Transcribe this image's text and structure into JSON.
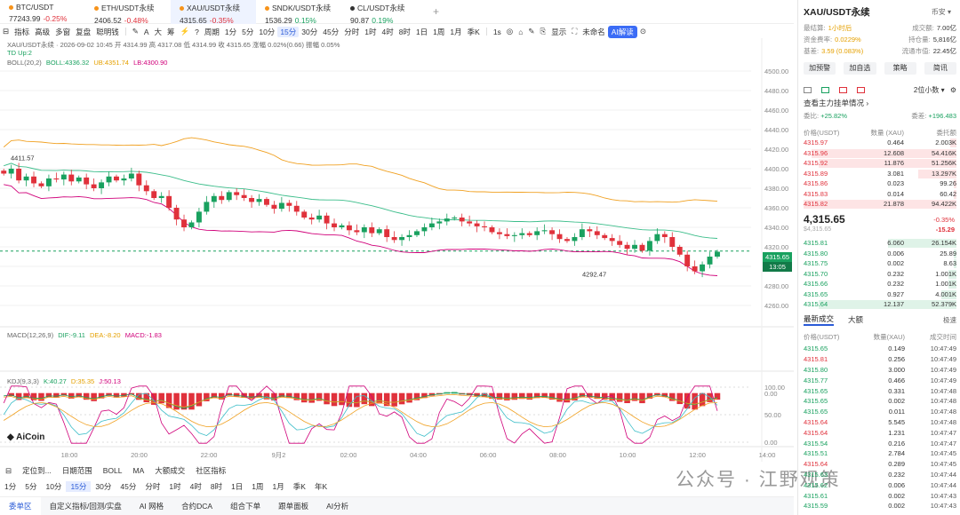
{
  "tickers": [
    {
      "name": "BTC/USDT",
      "price": "77243.99",
      "change": "-0.25%",
      "dir": "neg",
      "dot": "#f7931a"
    },
    {
      "name": "ETH/USDT永续",
      "price": "2406.52",
      "change": "-0.48%",
      "dir": "neg",
      "dot": "#f7931a"
    },
    {
      "name": "XAU/USDT永续",
      "price": "4315.65",
      "change": "-0.35%",
      "dir": "neg",
      "dot": "#f7931a"
    },
    {
      "name": "SNDK/USDT永续",
      "price": "1536.29",
      "change": "0.15%",
      "dir": "pos",
      "dot": "#f7931a"
    },
    {
      "name": "CL/USDT永续",
      "price": "90.87",
      "change": "0.19%",
      "dir": "pos",
      "dot": "#333333"
    }
  ],
  "toolbar": {
    "left": [
      "指标",
      "高级",
      "多窗",
      "复盘",
      "聪明钱"
    ],
    "period": "周期",
    "intervals": [
      "1分",
      "5分",
      "10分",
      "15分",
      "30分",
      "45分",
      "分时",
      "1时",
      "4时",
      "8时",
      "1日",
      "1周",
      "1月",
      "季K"
    ],
    "selected_interval": "15分",
    "fs": "1s",
    "display": "显示",
    "unnamed": "未命名",
    "ai": "AI解读"
  },
  "chart": {
    "info_line": "XAU/USDT永续 · 2026-09-02 10:45  开 4314.99  高 4317.08  低 4314.99  收 4315.65  涨幅 0.02%(0.66)  振幅 0.05%",
    "td": "TD  Up:2",
    "boll": {
      "label": "BOLL(20,2)",
      "boll": "BOLL:4336.32",
      "ub": "UB:4351.74",
      "lb": "LB:4300.90"
    },
    "macd": {
      "label": "MACD(12,26,9)",
      "dif": "DIF:-9.11",
      "dea": "DEA:-8.20",
      "macd": "MACD:-1.83"
    },
    "kdj": {
      "label": "KDJ(9,3,3)",
      "k": "K:40.27",
      "d": "D:35.35",
      "j": "J:50.13"
    },
    "price_axis": [
      "4500.00",
      "4480.00",
      "4460.00",
      "4440.00",
      "4420.00",
      "4400.00",
      "4380.00",
      "4360.00",
      "4340.00",
      "4320.00",
      "4300.00",
      "4280.00",
      "4260.00"
    ],
    "macd_axis": [
      "0.00"
    ],
    "kdj_axis": [
      "100.00",
      "50.00",
      "0.00"
    ],
    "time_axis": [
      "18:00",
      "20:00",
      "22:00",
      "9月2",
      "02:00",
      "04:00",
      "06:00",
      "08:00",
      "10:00",
      "12:00",
      "14:00"
    ],
    "current_price": "4315.65",
    "countdown": "13:05",
    "high_mark": "4411.57",
    "low_mark": "4292.47",
    "watermark": "AiCoin"
  },
  "bottom": {
    "row1": [
      "定位到...",
      "日期范围",
      "BOLL",
      "MA",
      "大额成交",
      "社区指标"
    ],
    "row2": [
      "1分",
      "5分",
      "10分",
      "15分",
      "30分",
      "45分",
      "分时",
      "1时",
      "4时",
      "8时",
      "1日",
      "1周",
      "1月",
      "季K",
      "年K"
    ],
    "row2_selected": "15分",
    "row3": [
      "委单区",
      "自定义指标/回测/实盘",
      "AI 网格",
      "合约DCA",
      "组合下单",
      "跟单面板",
      "AI分析"
    ],
    "row3_selected": "委单区"
  },
  "right": {
    "symbol": "XAU/USDT永续",
    "exchange": "币安",
    "stats": [
      [
        "最结算:",
        "1小时后",
        "成交额:",
        "7.00亿"
      ],
      [
        "资金费率:",
        "0.0229%",
        "持仓量:",
        "5,816亿"
      ],
      [
        "基差:",
        "3.59 (0.083%)",
        "流通市值:",
        "22.45亿"
      ]
    ],
    "buttons": [
      "加预警",
      "加自选",
      "策略",
      "简讯"
    ],
    "depth_sel": "2位小数",
    "main_flow": "查看主力挂单情况",
    "ratio_left_k": "委比:",
    "ratio_left_v": "+25.82%",
    "ratio_right_k": "委差:",
    "ratio_right_v": "+196.483",
    "ob_headers": [
      "价格(USDT)",
      "数量 (XAU)",
      "委托额"
    ],
    "asks": [
      [
        "4315.97",
        "0.464",
        "2.003K",
        0.04
      ],
      [
        "4315.96",
        "12.608",
        "54.416K",
        0.95
      ],
      [
        "4315.92",
        "11.876",
        "51.256K",
        0.9
      ],
      [
        "4315.89",
        "3.081",
        "13.297K",
        0.25
      ],
      [
        "4315.86",
        "0.023",
        "99.26",
        0.02
      ],
      [
        "4315.83",
        "0.014",
        "60.42",
        0.02
      ],
      [
        "4315.82",
        "21.878",
        "94.422K",
        1.0
      ]
    ],
    "mid_price": "4,315.65",
    "mid_sub": "$4,315.65",
    "mid_pct": "-0.35%",
    "mid_abs": "-15.29",
    "bids": [
      [
        "4315.81",
        "6.060",
        "26.154K",
        0.45
      ],
      [
        "4315.80",
        "0.006",
        "25.89",
        0.02
      ],
      [
        "4315.75",
        "0.002",
        "8.63",
        0.02
      ],
      [
        "4315.70",
        "0.232",
        "1.001K",
        0.05
      ],
      [
        "4315.66",
        "0.232",
        "1.001K",
        0.05
      ],
      [
        "4315.65",
        "0.927",
        "4.001K",
        0.1
      ],
      [
        "4315.64",
        "12.137",
        "52.379K",
        0.9
      ]
    ],
    "trade_tabs": [
      "最新成交",
      "大额"
    ],
    "trade_opts": "极速",
    "trade_headers": [
      "价格(USDT)",
      "数量(XAU)",
      "成交时间"
    ],
    "trades": [
      [
        "4315.65",
        "0.149",
        "10:47:49",
        "pos"
      ],
      [
        "4315.81",
        "0.256",
        "10:47:49",
        "neg"
      ],
      [
        "4315.80",
        "3.000",
        "10:47:49",
        "pos"
      ],
      [
        "4315.77",
        "0.466",
        "10:47:49",
        "pos"
      ],
      [
        "4315.65",
        "0.331",
        "10:47:48",
        "pos"
      ],
      [
        "4315.65",
        "0.002",
        "10:47:48",
        "pos"
      ],
      [
        "4315.65",
        "0.011",
        "10:47:48",
        "pos"
      ],
      [
        "4315.64",
        "5.545",
        "10:47:48",
        "neg"
      ],
      [
        "4315.64",
        "1.231",
        "10:47:47",
        "neg"
      ],
      [
        "4315.54",
        "0.216",
        "10:47:47",
        "pos"
      ],
      [
        "4315.51",
        "2.784",
        "10:47:45",
        "pos"
      ],
      [
        "4315.64",
        "0.289",
        "10:47:45",
        "neg"
      ],
      [
        "4315.63",
        "0.232",
        "10:47:44",
        "pos"
      ],
      [
        "4315.62",
        "0.006",
        "10:47:44",
        "pos"
      ],
      [
        "4315.61",
        "0.002",
        "10:47:43",
        "pos"
      ],
      [
        "4315.59",
        "0.002",
        "10:47:43",
        "pos"
      ]
    ],
    "wm": "公众号 · 江野观策"
  }
}
